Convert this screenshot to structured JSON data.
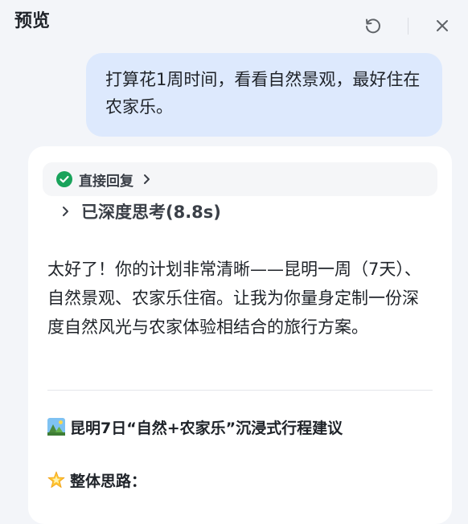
{
  "header": {
    "title": "预览"
  },
  "messages": {
    "user_text": "打算花1周时间，看看自然景观，最好住在农家乐。",
    "reply_tag_label": "直接回复",
    "thinking_label": "已深度思考(8.8s)",
    "answer_paragraph": "太好了！你的计划非常清晰——昆明一周（7天）、自然景观、农家乐住宿。让我为你量身定制一份深度自然风光与农家体验相结合的旅行方案。",
    "plan_title": "昆明7日“自然+农家乐”沉浸式行程建议",
    "overview_label": "整体思路："
  },
  "icons": {
    "refresh": "refresh-icon",
    "close": "close-icon",
    "check": "check-circle-icon",
    "chevron": "chevron-right-icon",
    "landscape": "landscape-emoji-icon",
    "star": "glowing-star-emoji-icon"
  },
  "colors": {
    "background": "#f3f5f9",
    "user_bubble": "#dde9fd",
    "card": "#ffffff",
    "check_green": "#19a35b"
  }
}
